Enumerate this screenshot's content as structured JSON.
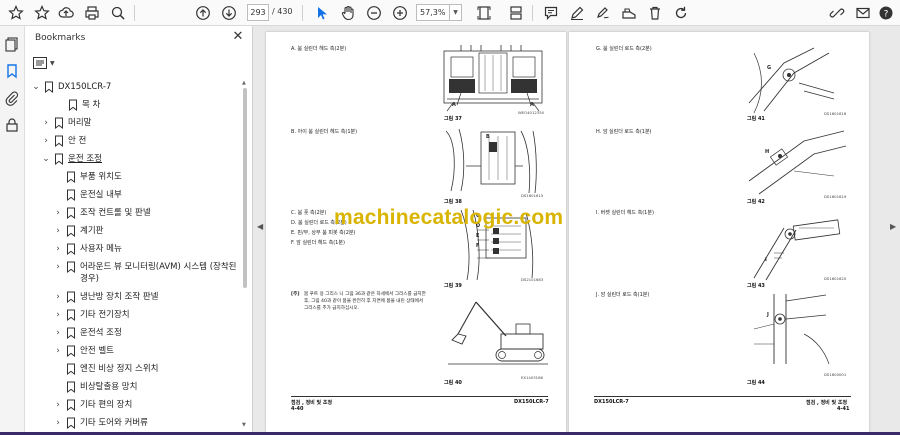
{
  "toolbar": {
    "page_current": "293",
    "page_total": "/ 430",
    "zoom": "57,3%"
  },
  "bookmarks_panel": {
    "title": "Bookmarks",
    "items": [
      {
        "label": "DX150LCR-7",
        "expanded": true,
        "has_children": true
      },
      {
        "label": "목 차"
      },
      {
        "label": "머리말",
        "has_children": true
      },
      {
        "label": "안 전",
        "has_children": true
      },
      {
        "label": "운전 조정",
        "has_children": true,
        "expanded": true
      },
      {
        "label": "부품 위치도"
      },
      {
        "label": "운전실 내부"
      },
      {
        "label": "조작 컨트롤 및 판넬",
        "has_children": true
      },
      {
        "label": "계기판",
        "has_children": true
      },
      {
        "label": "사용자 메뉴",
        "has_children": true
      },
      {
        "label": "어라운드 뷰 모니터링(AVM) 시스템 (장착된",
        "has_children": true
      },
      {
        "label": "경우)"
      },
      {
        "label": "냉난방 장치 조작 판넬",
        "has_children": true
      },
      {
        "label": "기타 전기장치",
        "has_children": true
      },
      {
        "label": "운전석 조정",
        "has_children": true
      },
      {
        "label": "안전 벨트",
        "has_children": true
      },
      {
        "label": "엔진 비상 정지 스위치"
      },
      {
        "label": "비상탈출용 망치"
      },
      {
        "label": "기타 편의 장치",
        "has_children": true
      },
      {
        "label": "기타 도어와 커버류",
        "has_children": true
      }
    ]
  },
  "left_page": {
    "captions": {
      "a": "A.     붐 실린더 헤드 측(2분)",
      "b": "B.     아이 붐 실린더 헤드 측(1분)",
      "c": "C.     붐 풋 측(2분)",
      "d": "D.     붐 실린더 로드 측(2분)",
      "e": "E.     핀/부, 상부 붐 피봇 측(2분)",
      "f": "F.     암 실린더 헤드 측(1분)"
    },
    "note_label": "[주]",
    "note": "붐 푸트 용 그리스 니 그림 36과 같은 자세에서 그리스를 급지한 후, 그림 40과 같이 붐을 완전히 후 지면에 붐을 내린 상태에서 그리스를 추가 급지하십시오.",
    "figures": {
      "f37": "그림 37",
      "f38": "그림 38",
      "f39": "그림 39",
      "f40": "그림 40"
    },
    "codes": {
      "c37": "WEO4012350",
      "c38": "DS1601615",
      "c39": "DS2101683",
      "c40": "EX1403166"
    },
    "callouts": {
      "a": "A",
      "b": "B",
      "c": "C",
      "d": "D",
      "e": "E",
      "f": "F"
    },
    "footer_left_title": "점검 , 정비 및 조정",
    "footer_left_page": "4-40",
    "footer_right": "DX150LCR-7"
  },
  "right_page": {
    "captions": {
      "g": "G.     붐 실린더 로드 측(2분)",
      "h": "H.     암 실린더 로드 측(1분)",
      "i": "I.     버켓 실린더 헤드 측(1분)",
      "j": "J.     암 실린더 로드 측(1분)"
    },
    "figures": {
      "f41": "그림 41",
      "f42": "그림 42",
      "f43": "그림 43",
      "f44": "그림 44"
    },
    "codes": {
      "c41": "DS1601616",
      "c42": "DS1601619",
      "c43": "DS1601620",
      "c44": "DS1600001"
    },
    "callouts": {
      "g": "G",
      "h": "H",
      "i": "I",
      "j": "J"
    },
    "footer_left": "DX150LCR-7",
    "footer_right_title": "점검 , 정비 및 조정",
    "footer_right_page": "4-41"
  },
  "watermark": "machinecatalogic.com",
  "colors": {
    "accent": "#1473e6",
    "watermark": "#d9b400",
    "bottom_bar": "#3a2a6a"
  }
}
